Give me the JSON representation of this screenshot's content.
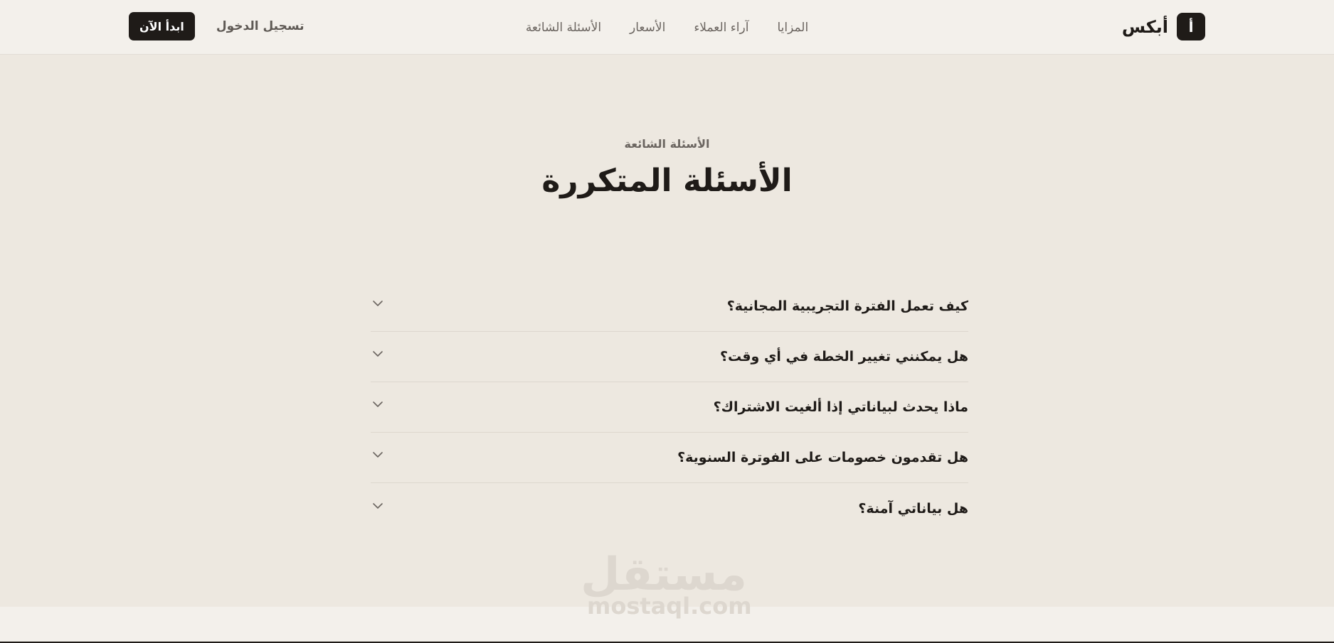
{
  "header": {
    "brand": {
      "mark": "أ",
      "name": "أبكس"
    },
    "nav": [
      {
        "label": "المزايا"
      },
      {
        "label": "آراء العملاء"
      },
      {
        "label": "الأسعار"
      },
      {
        "label": "الأسئلة الشائعة"
      }
    ],
    "login_label": "تسجيل الدخول",
    "cta_label": "ابدأ الآن"
  },
  "faq": {
    "eyebrow": "الأسئلة الشائعة",
    "title": "الأسئلة المتكررة",
    "items": [
      {
        "question": "كيف تعمل الفترة التجريبية المجانية؟"
      },
      {
        "question": "هل يمكنني تغيير الخطة في أي وقت؟"
      },
      {
        "question": "ماذا يحدث لبياناتي إذا ألغيت الاشتراك؟"
      },
      {
        "question": "هل تقدمون خصومات على الفوترة السنوية؟"
      },
      {
        "question": "هل بياناتي آمنة؟"
      }
    ],
    "chevron_icon": "chevron-down-icon"
  },
  "watermark": {
    "ar": "مستقل",
    "en": "mostaql.com"
  },
  "colors": {
    "background": "#ede8e0",
    "header": "#f3f0eb",
    "primary": "#1f1b18",
    "muted": "#6b6560"
  }
}
